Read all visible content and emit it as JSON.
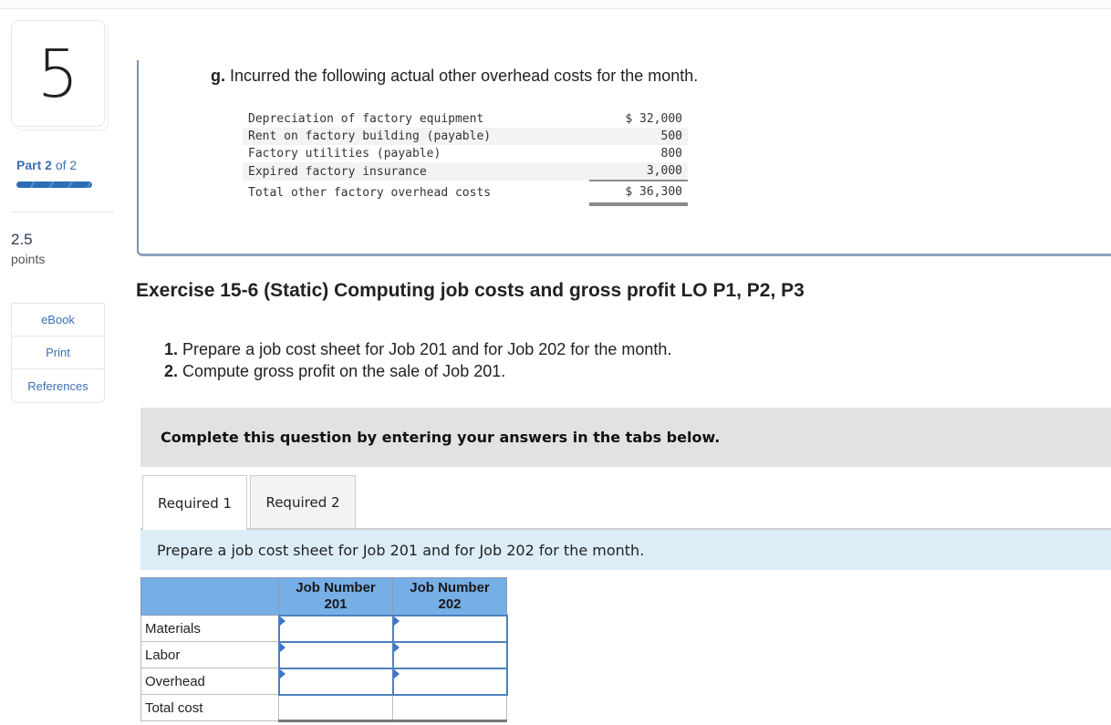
{
  "sidebar": {
    "question_number": "5",
    "part_label": "Part",
    "part_current": "2",
    "part_of": "of 2",
    "progress_fraction": 1.0,
    "points_value": "2.5",
    "points_label": "points",
    "buttons": [
      {
        "label": "eBook"
      },
      {
        "label": "Print"
      },
      {
        "label": "References"
      }
    ]
  },
  "overhead": {
    "item_letter": "g.",
    "intro": "Incurred the following actual other overhead costs for the month.",
    "rows": [
      {
        "label": "Depreciation of factory equipment",
        "amount": "$ 32,000"
      },
      {
        "label": "Rent on factory building (payable)",
        "amount": "500"
      },
      {
        "label": "Factory utilities (payable)",
        "amount": "800"
      },
      {
        "label": "Expired factory insurance",
        "amount": "3,000"
      }
    ],
    "total": {
      "label": "Total other factory overhead costs",
      "amount": "$ 36,300"
    }
  },
  "exercise": {
    "title": "Exercise 15-6 (Static) Computing job costs and gross profit LO P1, P2, P3",
    "tasks": [
      {
        "num": "1.",
        "text": "Prepare a job cost sheet for Job 201 and for Job 202 for the month."
      },
      {
        "num": "2.",
        "text": "Compute gross profit on the sale of Job 201."
      }
    ]
  },
  "complete_banner": "Complete this question by entering your answers in the tabs below.",
  "tabs": [
    {
      "label": "Required 1",
      "active": true
    },
    {
      "label": "Required 2",
      "active": false
    }
  ],
  "instruction": "Prepare a job cost sheet for Job 201 and for Job 202 for the month.",
  "job_table": {
    "columns": [
      "Job Number 201",
      "Job Number 202"
    ],
    "col_line1": [
      "Job Number",
      "Job Number"
    ],
    "col_line2": [
      "201",
      "202"
    ],
    "rows": [
      {
        "label": "Materials",
        "values": [
          "",
          ""
        ]
      },
      {
        "label": "Labor",
        "values": [
          "",
          ""
        ]
      },
      {
        "label": "Overhead",
        "values": [
          "",
          ""
        ]
      },
      {
        "label": "Total cost",
        "values": [
          "",
          ""
        ]
      }
    ]
  }
}
